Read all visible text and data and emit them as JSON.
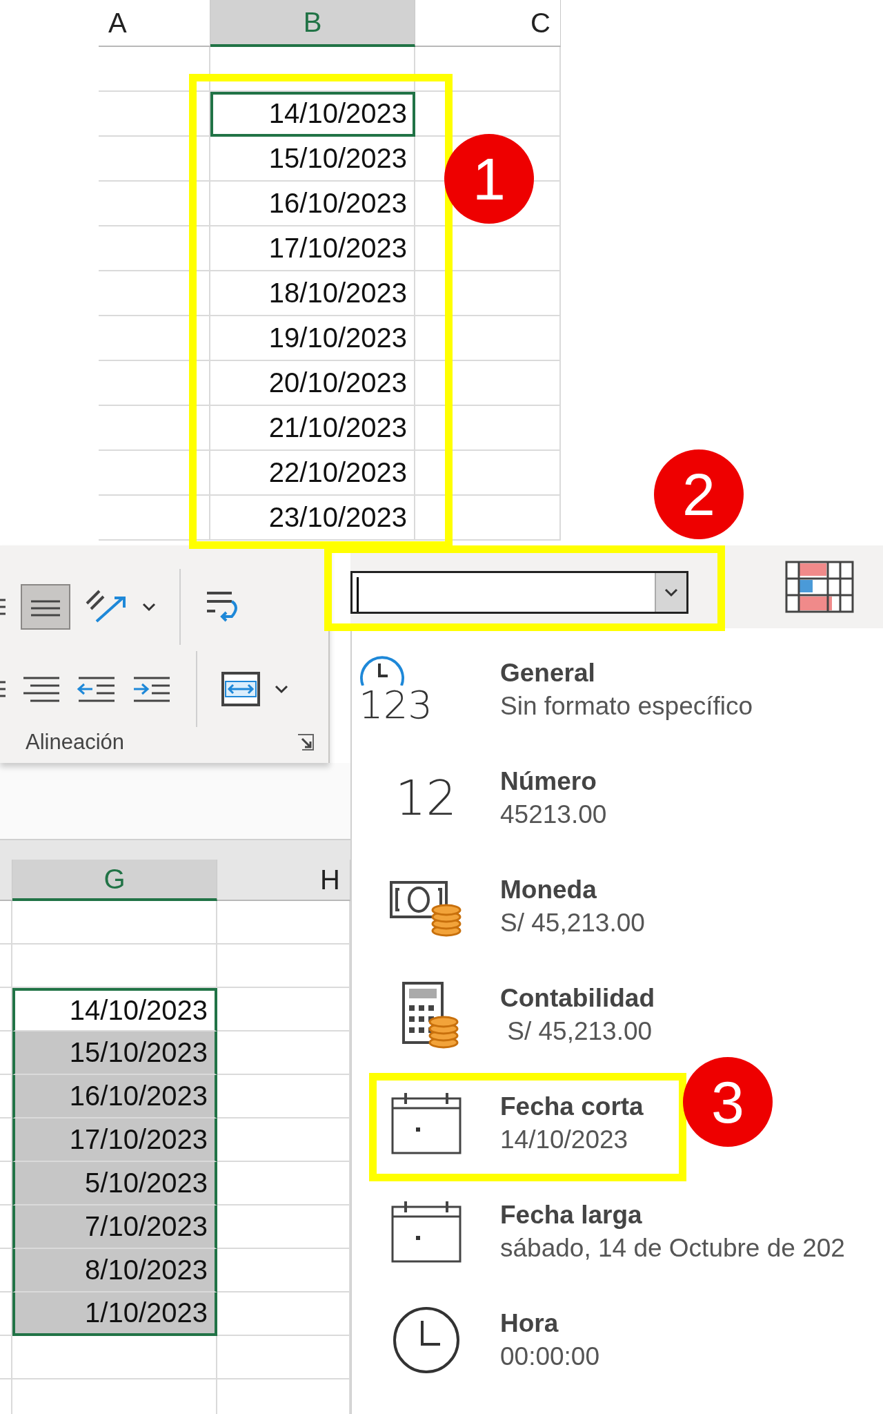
{
  "top_sheet": {
    "columns": [
      {
        "label": "A",
        "selected": false
      },
      {
        "label": "B",
        "selected": true
      },
      {
        "label": "C",
        "selected": false
      }
    ],
    "cells": [
      {
        "value": "14/10/2023",
        "active": true
      },
      {
        "value": "15/10/2023",
        "active": false
      },
      {
        "value": "16/10/2023",
        "active": false
      },
      {
        "value": "17/10/2023",
        "active": false
      },
      {
        "value": "18/10/2023",
        "active": false
      },
      {
        "value": "19/10/2023",
        "active": false
      },
      {
        "value": "20/10/2023",
        "active": false
      },
      {
        "value": "21/10/2023",
        "active": false
      },
      {
        "value": "22/10/2023",
        "active": false
      },
      {
        "value": "23/10/2023",
        "active": false
      }
    ]
  },
  "ribbon": {
    "group_label": "Alineación",
    "middle_align_selected": true
  },
  "number_format": {
    "menu_open": true
  },
  "format_menu": [
    {
      "kind": "general",
      "glyph": "123",
      "title": "General",
      "example": "Sin formato específico"
    },
    {
      "kind": "number",
      "glyph": "12",
      "title": "Número",
      "example": "45213.00"
    },
    {
      "kind": "currency",
      "title": "Moneda",
      "example": "S/ 45,213.00"
    },
    {
      "kind": "accounting",
      "title": "Contabilidad",
      "example": " S/ 45,213.00"
    },
    {
      "kind": "short_date",
      "title": "Fecha corta",
      "example": "14/10/2023"
    },
    {
      "kind": "long_date",
      "title": "Fecha larga",
      "example": "sábado, 14 de Octubre de 202"
    },
    {
      "kind": "time",
      "title": "Hora",
      "example": "00:00:00"
    }
  ],
  "bottom_sheet": {
    "columns": [
      {
        "label": "G",
        "selected": true
      },
      {
        "label": "H",
        "selected": false
      }
    ],
    "cells": [
      {
        "value": "14/10/2023",
        "active": true
      },
      {
        "value": "15/10/2023",
        "active": false
      },
      {
        "value": "16/10/2023",
        "active": false
      },
      {
        "value": "17/10/2023",
        "active": false
      },
      {
        "value": "5/10/2023",
        "active": false
      },
      {
        "value": "7/10/2023",
        "active": false
      },
      {
        "value": "8/10/2023",
        "active": false
      },
      {
        "value": "1/10/2023",
        "active": false
      }
    ]
  },
  "annotations": [
    {
      "label": "1"
    },
    {
      "label": "2"
    },
    {
      "label": "3"
    }
  ]
}
